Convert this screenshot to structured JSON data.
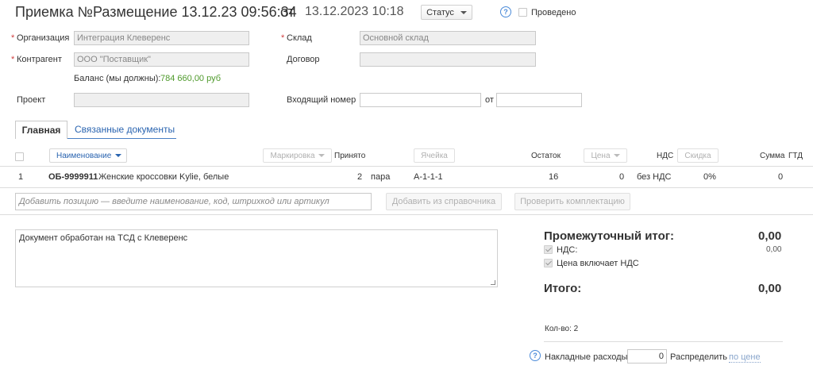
{
  "header": {
    "doc_type": "Приемка №",
    "doc_name": "Размещение 13.12.23 09:56:34",
    "from_word": "от",
    "date": "13.12.2023 10:18",
    "status_label": "Статус",
    "help_glyph": "?",
    "posted_label": "Проведено",
    "posted_checked": false
  },
  "form": {
    "organization_label": "Организация",
    "organization_value": "Интеграция Клеверенс",
    "warehouse_label": "Склад",
    "warehouse_value": "Основной склад",
    "counterparty_label": "Контрагент",
    "counterparty_value": "ООО \"Поставщик\"",
    "contract_label": "Договор",
    "contract_value": "",
    "balance_label": "Баланс (мы должны):",
    "balance_value": "784 660,00 руб",
    "project_label": "Проект",
    "project_value": "",
    "incoming_number_label": "Входящий номер",
    "incoming_number_value": "",
    "incoming_from_label": "от",
    "incoming_from_value": "",
    "required_mark": "*"
  },
  "tabs": [
    {
      "label": "Главная",
      "active": true
    },
    {
      "label": "Связанные документы",
      "active": false
    }
  ],
  "table": {
    "headers": {
      "name": "Наименование",
      "marking": "Маркировка",
      "accepted": "Принято",
      "cell": "Ячейка",
      "remain": "Остаток",
      "price": "Цена",
      "vat": "НДС",
      "discount": "Скидка",
      "sum": "Сумма",
      "gtd": "ГТД"
    },
    "rows": [
      {
        "num": "1",
        "code": "ОБ-9999911",
        "name": "Женские кроссовки Kylie, белые",
        "qty": "2",
        "unit": "пара",
        "cell": "А-1-1-1",
        "remain": "16",
        "price": "0",
        "vat": "без НДС",
        "discount": "0%",
        "sum": "0"
      }
    ],
    "add_placeholder": "Добавить позицию — введите наименование, код, штрихкод или артикул",
    "add_from_catalog": "Добавить из справочника",
    "check_kit": "Проверить комплектацию"
  },
  "comment": "Документ обработан на ТСД с Клеверенс",
  "totals": {
    "subtotal_label": "Промежуточный итог:",
    "subtotal_value": "0,00",
    "vat_label": "НДС:",
    "vat_value": "0,00",
    "price_incl_vat_label": "Цена включает НДС",
    "total_label": "Итого:",
    "total_value": "0,00",
    "qty_label": "Кол-во: 2",
    "overhead_label": "Накладные расходы",
    "overhead_value": "0",
    "distribute_label": "Распределить",
    "distribute_link": "по цене"
  }
}
